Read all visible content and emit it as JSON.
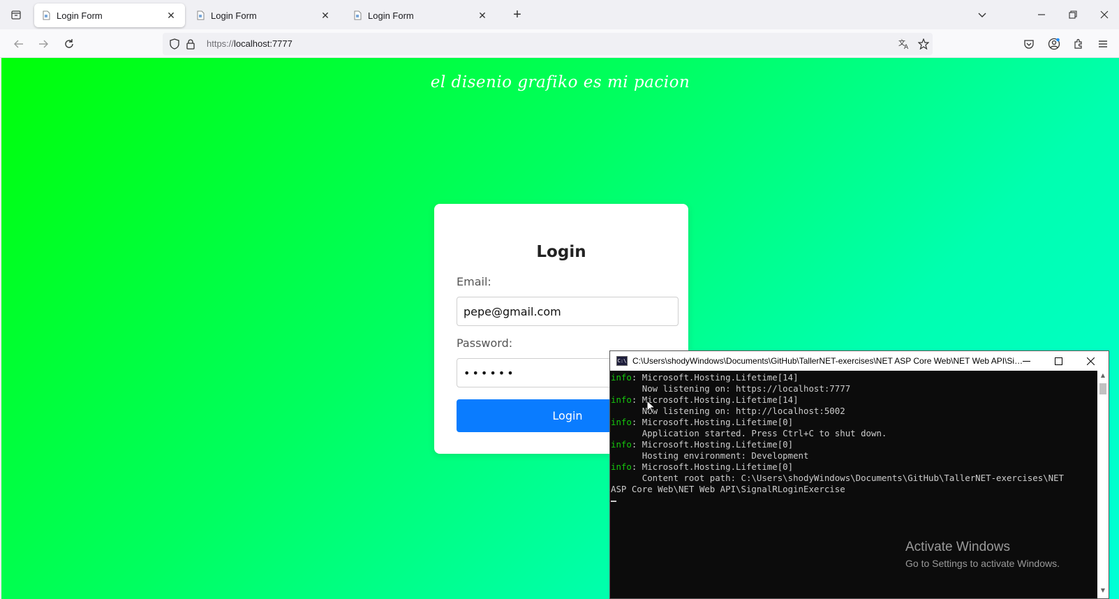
{
  "browser": {
    "tabs": [
      {
        "title": "Login Form",
        "active": true
      },
      {
        "title": "Login Form",
        "active": false
      },
      {
        "title": "Login Form",
        "active": false
      }
    ],
    "url_scheme": "https://",
    "url_host": "localhost:7777"
  },
  "page": {
    "slogan": "el disenio grafiko es mi pacion",
    "login": {
      "title": "Login",
      "email_label": "Email:",
      "email_value": "pepe@gmail.com",
      "password_label": "Password:",
      "password_value": "••••••",
      "button_label": "Login"
    },
    "gradient_colors": [
      "#00ff08",
      "#00ffd6"
    ],
    "button_color": "#0a7cff"
  },
  "console": {
    "title": "C:\\Users\\shodyWindows\\Documents\\GitHub\\TallerNET-exercises\\NET ASP Core Web\\NET Web API\\Sign...",
    "icon_text": "C:\\",
    "lines": [
      {
        "level": "info",
        "text": ": Microsoft.Hosting.Lifetime[14]"
      },
      {
        "level": "",
        "text": "      Now listening on: https://localhost:7777"
      },
      {
        "level": "info",
        "text": ": Microsoft.Hosting.Lifetime[14]"
      },
      {
        "level": "",
        "text": "      Now listening on: http://localhost:5002"
      },
      {
        "level": "info",
        "text": ": Microsoft.Hosting.Lifetime[0]"
      },
      {
        "level": "",
        "text": "      Application started. Press Ctrl+C to shut down."
      },
      {
        "level": "info",
        "text": ": Microsoft.Hosting.Lifetime[0]"
      },
      {
        "level": "",
        "text": "      Hosting environment: Development"
      },
      {
        "level": "info",
        "text": ": Microsoft.Hosting.Lifetime[0]"
      },
      {
        "level": "",
        "text": "      Content root path: C:\\Users\\shodyWindows\\Documents\\GitHub\\TallerNET-exercises\\NET"
      },
      {
        "level": "",
        "text": "ASP Core Web\\NET Web API\\SignalRLoginExercise"
      }
    ]
  },
  "watermark": {
    "line1": "Activate Windows",
    "line2": "Go to Settings to activate Windows."
  }
}
